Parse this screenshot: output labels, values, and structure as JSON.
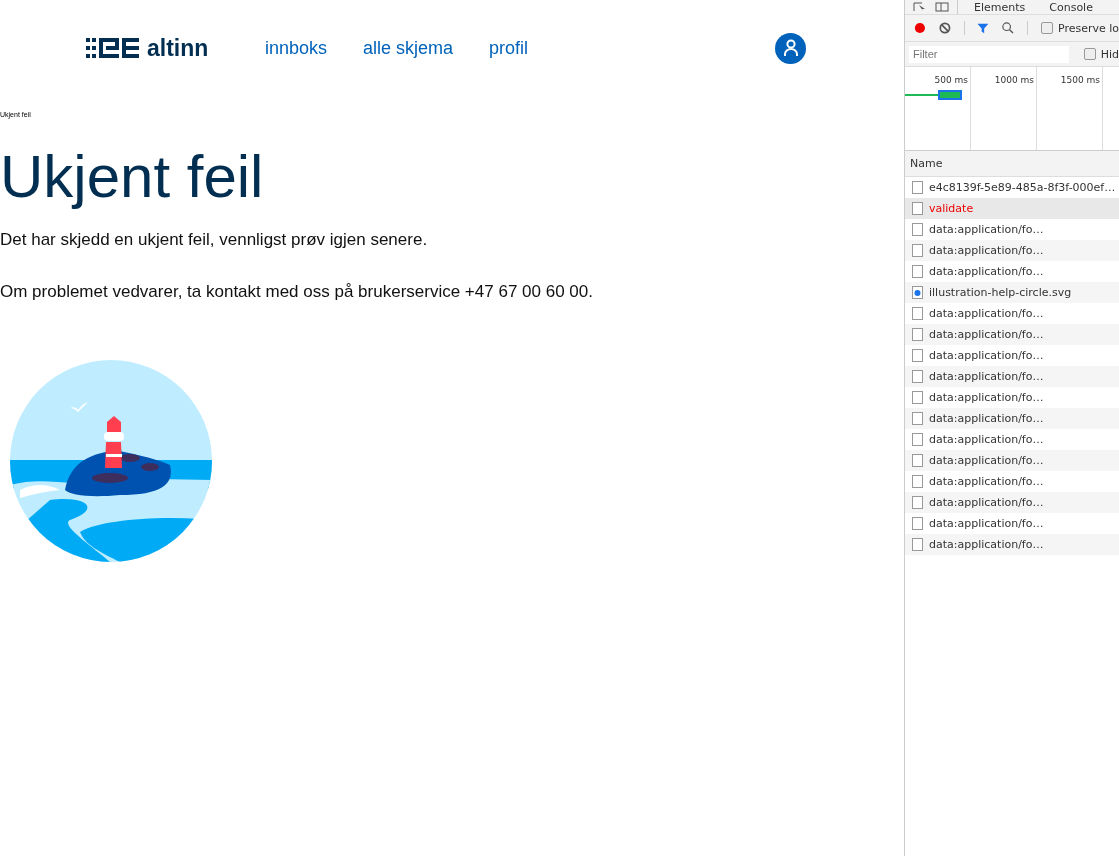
{
  "header": {
    "logo_text": "altinn",
    "nav": [
      {
        "label": "innboks"
      },
      {
        "label": "alle skjema"
      },
      {
        "label": "profil"
      }
    ]
  },
  "breadcrumb": "Ukjent feil",
  "title": "Ukjent feil",
  "paragraphs": [
    "Det har skjedd en ukjent feil, vennligst prøv igjen senere.",
    "Om problemet vedvarer, ta kontakt med oss på brukerservice +47 67 00 60 00."
  ],
  "devtools": {
    "tabs": [
      {
        "label": "Elements",
        "selected": false
      },
      {
        "label": "Console",
        "selected": false
      }
    ],
    "recording": true,
    "preserve_log": {
      "label": "Preserve lo",
      "checked": false
    },
    "filter": {
      "placeholder": "Filter"
    },
    "hide": {
      "label": "Hid",
      "checked": false
    },
    "timeline_ticks": [
      "500 ms",
      "1000 ms",
      "1500 ms"
    ],
    "column": "Name",
    "requests": [
      {
        "name": "e4c8139f-5e89-485a-8f3f-000ef…",
        "kind": "doc",
        "failed": false,
        "selected": false
      },
      {
        "name": "validate",
        "kind": "doc",
        "failed": true,
        "selected": true
      },
      {
        "name": "data:application/fo…",
        "kind": "doc",
        "failed": false,
        "selected": false
      },
      {
        "name": "data:application/fo…",
        "kind": "doc",
        "failed": false,
        "selected": false
      },
      {
        "name": "data:application/fo…",
        "kind": "doc",
        "failed": false,
        "selected": false
      },
      {
        "name": "illustration-help-circle.svg",
        "kind": "image",
        "failed": false,
        "selected": false
      },
      {
        "name": "data:application/fo…",
        "kind": "doc",
        "failed": false,
        "selected": false
      },
      {
        "name": "data:application/fo…",
        "kind": "doc",
        "failed": false,
        "selected": false
      },
      {
        "name": "data:application/fo…",
        "kind": "doc",
        "failed": false,
        "selected": false
      },
      {
        "name": "data:application/fo…",
        "kind": "doc",
        "failed": false,
        "selected": false
      },
      {
        "name": "data:application/fo…",
        "kind": "doc",
        "failed": false,
        "selected": false
      },
      {
        "name": "data:application/fo…",
        "kind": "doc",
        "failed": false,
        "selected": false
      },
      {
        "name": "data:application/fo…",
        "kind": "doc",
        "failed": false,
        "selected": false
      },
      {
        "name": "data:application/fo…",
        "kind": "doc",
        "failed": false,
        "selected": false
      },
      {
        "name": "data:application/fo…",
        "kind": "doc",
        "failed": false,
        "selected": false
      },
      {
        "name": "data:application/fo…",
        "kind": "doc",
        "failed": false,
        "selected": false
      },
      {
        "name": "data:application/fo…",
        "kind": "doc",
        "failed": false,
        "selected": false
      },
      {
        "name": "data:application/fo…",
        "kind": "doc",
        "failed": false,
        "selected": false
      }
    ]
  }
}
